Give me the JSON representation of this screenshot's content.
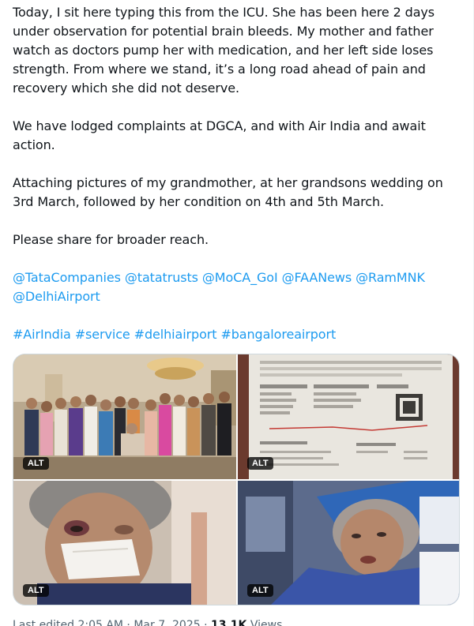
{
  "post": {
    "para1": "Today, I sit here typing this from the ICU. She has been here 2 days under observation for potential brain bleeds. My mother and father watch as doctors pump her with medication, and her left side loses strength. From where we stand, it’s a long road ahead of pain and recovery which she did not deserve.",
    "para2": "We have lodged complaints at DGCA, and with Air India and await action.",
    "para3": "Attaching pictures of my grandmother, at her grandsons wedding on 3rd March, followed by her condition on 4th and 5th March.",
    "para4": "Please share for broader reach.",
    "mentions": [
      "@TataCompanies",
      "@tatatrusts",
      "@MoCA_GoI",
      "@FAANews",
      "@RamMNK",
      "@DelhiAirport"
    ],
    "hashtags": [
      "#AirIndia",
      "#service",
      "#delhiairport",
      "#bangaloreairport"
    ]
  },
  "media": {
    "alt_label": "ALT",
    "photo_icons": [
      "family-wedding-photo",
      "boarding-pass-photo",
      "injured-face-photo",
      "hospital-bed-photo"
    ]
  },
  "meta": {
    "edited": "Last edited 2:05 AM · Mar 7, 2025 · ",
    "views_count": "13.1K",
    "views_label": " Views"
  },
  "colors": {
    "link": "#1d9bf0",
    "text": "#0f1419",
    "secondary": "#536471",
    "border": "#cfd9de"
  }
}
